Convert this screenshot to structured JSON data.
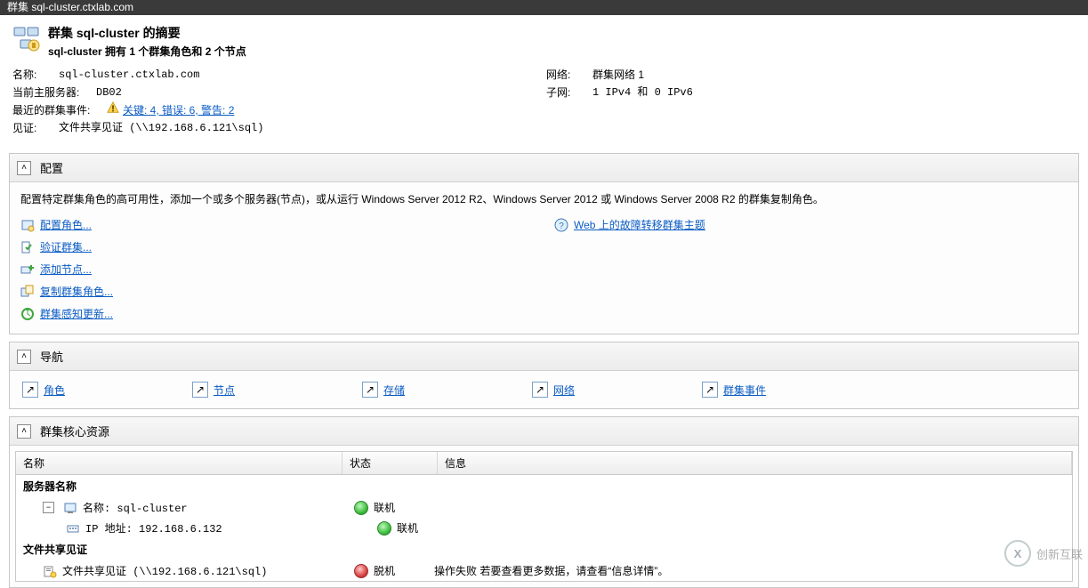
{
  "window": {
    "title": "群集 sql-cluster.ctxlab.com"
  },
  "summary": {
    "title": "群集 sql-cluster 的摘要",
    "subtitle": "sql-cluster 拥有 1 个群集角色和 2 个节点"
  },
  "details": {
    "name_label": "名称:",
    "name_value": "sql-cluster.ctxlab.com",
    "owner_label": "当前主服务器:",
    "owner_value": "DB02",
    "events_label": "最近的群集事件:",
    "events_link": "关键: 4, 错误: 6, 警告: 2",
    "witness_label": "见证:",
    "witness_value": "文件共享见证 (\\\\192.168.6.121\\sql)",
    "network_label": "网络:",
    "network_value": "群集网络 1",
    "subnet_label": "子网:",
    "subnet_value": "1 IPv4 和 0 IPv6"
  },
  "sections": {
    "config": {
      "title": "配置",
      "description": "配置特定群集角色的高可用性，添加一个或多个服务器(节点)，或从运行 Windows Server 2012 R2、Windows Server 2012 或 Windows Server 2008 R2 的群集复制角色。",
      "actions": {
        "configure_role": "配置角色...",
        "validate_cluster": "验证群集...",
        "add_node": "添加节点...",
        "copy_roles": "复制群集角色...",
        "cluster_aware_update": "群集感知更新..."
      },
      "help_link": "Web 上的故障转移群集主题"
    },
    "nav": {
      "title": "导航",
      "items": {
        "roles": "角色",
        "nodes": "节点",
        "storage": "存储",
        "networks": "网络",
        "events": "群集事件"
      }
    },
    "resources": {
      "title": "群集核心资源",
      "columns": {
        "name": "名称",
        "state": "状态",
        "info": "信息"
      },
      "group_server": "服务器名称",
      "row_cluster_name": "名称: sql-cluster",
      "row_ip": "IP 地址: 192.168.6.132",
      "group_witness": "文件共享见证",
      "row_witness": "文件共享见证 (\\\\192.168.6.121\\sql)",
      "state_online": "联机",
      "state_offline": "脱机",
      "witness_info": "操作失败  若要查看更多数据，请查看“信息详情”。"
    }
  },
  "watermark": "创新互联"
}
